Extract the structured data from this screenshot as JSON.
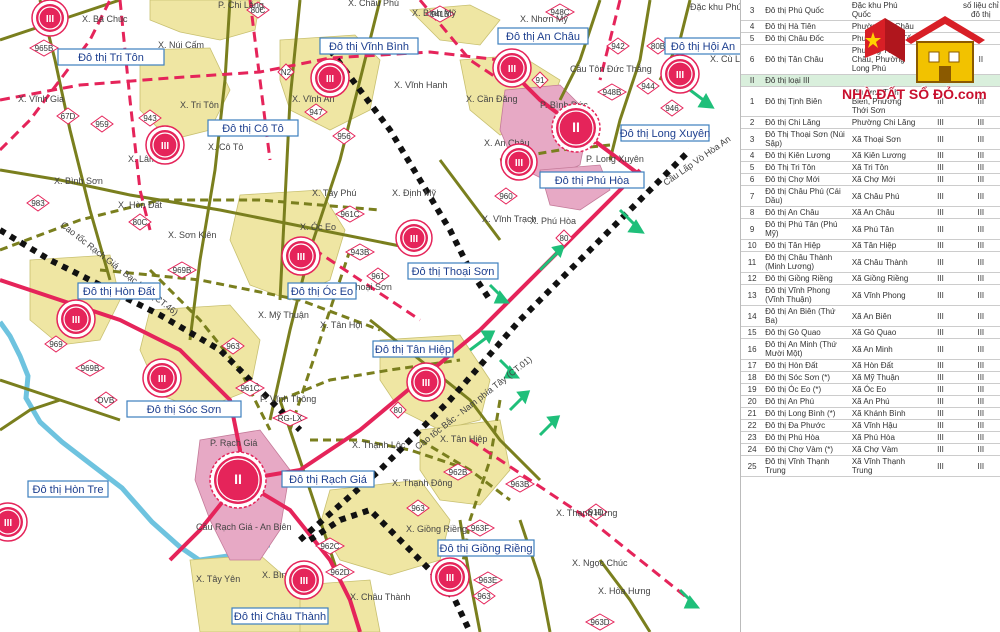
{
  "map": {
    "city_labels": [
      "Đô thị Tri Tôn",
      "Đô thị Vĩnh Bình",
      "Đô thị An Châu",
      "Đô thị Hội An",
      "Đô thị Cô Tô",
      "Đô thị Long Xuyên",
      "Đô thị Phú Hòa",
      "Đô thị Óc Eo",
      "Đô thị Thoại Sơn",
      "Đô thị Hòn Đất",
      "Đô thị Tân Hiệp",
      "Đô thị Sóc Sơn",
      "Đô thị Rạch Giá",
      "Đô thị Hòn Tre",
      "Đô thị Giồng Riềng",
      "Đô thị Châu Thành"
    ],
    "commune_labels": [
      "X. Bà Chúc",
      "P. Chi Lăng",
      "X. Châu Phú",
      "X. Bình Mỹ",
      "X. Nhơn Mỹ",
      "Đặc khu Phú Quốc",
      "X. Núi Cấm",
      "X. Cù Lao Giêng",
      "X. Vĩnh Hanh",
      "X. Cần Đăng",
      "X. Vĩnh Gia",
      "X. Vĩnh An",
      "X. Tri Tôn",
      "X. Cô Tô",
      "X. An Châu",
      "X. Lâm",
      "X. Bình Sơn",
      "X. Hòn Đất",
      "X. Tây Phú",
      "X. Định Mỹ",
      "X. Sơn Kiên",
      "X. Óc Eo",
      "X. Vĩnh Trạch",
      "X. Phú Hòa",
      "X. Mỹ Thuận",
      "X. Tân Hội",
      "X. Tân Hiệp",
      "X. Thạnh Lộc",
      "X. Thạnh Đông",
      "X. Thạnh Hưng",
      "X. Giồng Riềng",
      "X. Ngọc Chúc",
      "X. Hòa Hưng",
      "X. Tây Yên",
      "X. Bình An",
      "X. Châu Thành",
      "P. Rạch Giá",
      "P. Vĩnh Thông",
      "P. Bình Đức",
      "P. Long Xuyên",
      "Thoại Sơn",
      "Cầu Tôn Đức Thắng",
      "Cầu Rạch Giá - An Biên",
      "Cầu Lấp Vò Hòa An",
      "Cao tốc Rạch Giá - Bạc Liêu (CT.46)",
      "Cao tốc Bắc - Nam phía Tây (CT.01)"
    ],
    "road_labels": [
      "80C",
      "941B",
      "948C",
      "965B",
      "942",
      "80B",
      "N2",
      "946",
      "944",
      "67D",
      "91",
      "948B",
      "943",
      "959",
      "947",
      "956",
      "80",
      "961C",
      "960",
      "983",
      "80C",
      "943B",
      "969B",
      "961",
      "969",
      "963",
      "969B",
      "961C",
      "DVB",
      "RG-LX",
      "80",
      "962B",
      "963B",
      "963",
      "962C",
      "962D",
      "963F",
      "963E",
      "963",
      "91D",
      "963D"
    ],
    "class_mark": "III",
    "class_mark_major": "II",
    "colors": {
      "route_red": "#e5245a",
      "province_road": "#7a7f1e",
      "urban_fill": "#efe6a3",
      "urban_core": "#e7a9c5",
      "water": "#6ec3df",
      "node": "#e5245a",
      "label_blue": "#1d3f8f",
      "label_box_border": "#3d7fbf",
      "arrow": "#1fbf7a",
      "section_band": "#d9efdc"
    },
    "icons": [
      "city-node-icon",
      "road-shield-icon",
      "direction-arrow-icon",
      "railway-dotted-line"
    ]
  },
  "table": {
    "rows": [
      {
        "stt": "3",
        "name": "Đô thị Phú Quốc",
        "area": "Đặc khu Phú Quốc",
        "c4": "",
        "c5": "số liệu chỉ đô thị"
      },
      {
        "stt": "4",
        "name": "Đô thị Hà Tiên",
        "area": "Phường Tô Châu",
        "c4": "",
        "c5": ""
      },
      {
        "stt": "5",
        "name": "Đô thị Châu Đốc",
        "area": "Phường Vĩnh Tế",
        "c4": "",
        "c5": ""
      },
      {
        "stt": "6",
        "name": "Đô thị Tân Châu",
        "area": "Phường Tân Châu, Phường Long Phú",
        "c4": "II",
        "c5": "II"
      },
      {
        "stt": "II",
        "name": "Đô thị loại III",
        "area": "",
        "c4": "",
        "c5": "",
        "section": true
      },
      {
        "stt": "1",
        "name": "Đô thị Tịnh Biên",
        "area": "Phường Tịnh Biên, Phường Thới Sơn",
        "c4": "III",
        "c5": "III"
      },
      {
        "stt": "2",
        "name": "Đô thị Chi Lăng",
        "area": "Phường Chi Lăng",
        "c4": "III",
        "c5": "III"
      },
      {
        "stt": "3",
        "name": "Đô Thị Thoại Sơn (Núi Sập)",
        "area": "Xã Thoại Sơn",
        "c4": "III",
        "c5": "III"
      },
      {
        "stt": "4",
        "name": "Đô thị Kiên Lương",
        "area": "Xã Kiên Lương",
        "c4": "III",
        "c5": "III"
      },
      {
        "stt": "5",
        "name": "Đô Thị Tri Tôn",
        "area": "Xã Tri Tôn",
        "c4": "III",
        "c5": "III"
      },
      {
        "stt": "6",
        "name": "Đô thị Chợ Mới",
        "area": "Xã Chợ Mới",
        "c4": "III",
        "c5": "III"
      },
      {
        "stt": "7",
        "name": "Đô thị Châu Phú (Cái Dầu)",
        "area": "Xã Châu Phú",
        "c4": "III",
        "c5": "III"
      },
      {
        "stt": "8",
        "name": "Đô thị An Châu",
        "area": "Xã An Châu",
        "c4": "III",
        "c5": "III"
      },
      {
        "stt": "9",
        "name": "Đô thị Phú Tân (Phú Mỹ)",
        "area": "Xã Phú Tân",
        "c4": "III",
        "c5": "III"
      },
      {
        "stt": "10",
        "name": "Đô thị Tân Hiệp",
        "area": "Xã Tân Hiệp",
        "c4": "III",
        "c5": "III"
      },
      {
        "stt": "11",
        "name": "Đô thị Châu Thành (Minh Lương)",
        "area": "Xã Châu Thành",
        "c4": "III",
        "c5": "III"
      },
      {
        "stt": "12",
        "name": "Đô thị Giồng Riềng",
        "area": "Xã Giồng Riềng",
        "c4": "III",
        "c5": "III"
      },
      {
        "stt": "13",
        "name": "Đô thị Vĩnh Phong (Vĩnh Thuận)",
        "area": "Xã Vĩnh Phong",
        "c4": "III",
        "c5": "III"
      },
      {
        "stt": "14",
        "name": "Đô thị An Biên (Thứ Ba)",
        "area": "Xã An Biên",
        "c4": "III",
        "c5": "III"
      },
      {
        "stt": "15",
        "name": "Đô thị Gò Quao",
        "area": "Xã Gò Quao",
        "c4": "III",
        "c5": "III"
      },
      {
        "stt": "16",
        "name": "Đô thị An Minh (Thứ Mười Một)",
        "area": "Xã An Minh",
        "c4": "III",
        "c5": "III"
      },
      {
        "stt": "17",
        "name": "Đô thị Hòn Đất",
        "area": "Xã Hòn Đất",
        "c4": "III",
        "c5": "III"
      },
      {
        "stt": "18",
        "name": "Đô thị Sóc Sơn (*)",
        "area": "Xã Mỹ Thuận",
        "c4": "III",
        "c5": "III"
      },
      {
        "stt": "19",
        "name": "Đô thị Óc Eo (*)",
        "area": "Xã Óc Eo",
        "c4": "III",
        "c5": "III"
      },
      {
        "stt": "20",
        "name": "Đô thị An Phú",
        "area": "Xã An Phú",
        "c4": "III",
        "c5": "III"
      },
      {
        "stt": "21",
        "name": "Đô thị Long Bình (*)",
        "area": "Xã Khánh Bình",
        "c4": "III",
        "c5": "III"
      },
      {
        "stt": "22",
        "name": "Đô thị Đa Phước",
        "area": "Xã Vĩnh Hậu",
        "c4": "III",
        "c5": "III"
      },
      {
        "stt": "23",
        "name": "Đô thị Phú Hòa",
        "area": "Xã Phú Hòa",
        "c4": "III",
        "c5": "III"
      },
      {
        "stt": "24",
        "name": "Đô thị Chợ Vàm (*)",
        "area": "Xã Chợ Vàm",
        "c4": "III",
        "c5": "III"
      },
      {
        "stt": "25",
        "name": "Đô thị Vĩnh Thạnh Trung",
        "area": "Xã Vĩnh Thạnh Trung",
        "c4": "III",
        "c5": "III"
      }
    ]
  },
  "logo": {
    "text": "NHÀ ĐẤT SỔ ĐỎ.com"
  }
}
